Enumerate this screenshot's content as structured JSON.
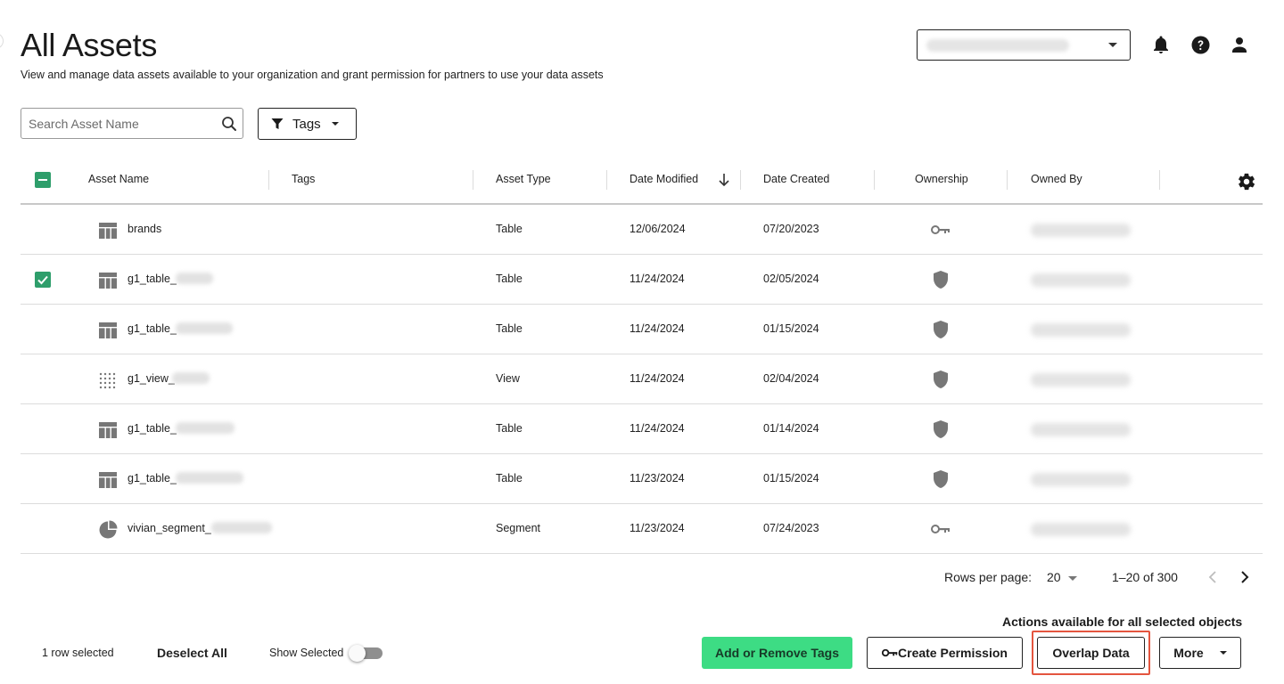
{
  "header": {
    "title": "All Assets",
    "subtitle": "View and manage data assets available to your organization and grant permission for partners to use your data assets",
    "icons": [
      "bell-icon",
      "help-icon",
      "user-icon"
    ]
  },
  "filters": {
    "search_placeholder": "Search Asset Name",
    "tags_label": "Tags"
  },
  "table": {
    "columns": {
      "asset_name": "Asset Name",
      "tags": "Tags",
      "asset_type": "Asset Type",
      "date_modified": "Date Modified",
      "date_created": "Date Created",
      "ownership": "Ownership",
      "owned_by": "Owned By"
    },
    "sort_indicator": "arrow-down-icon",
    "rows": [
      {
        "name": "brands",
        "type": "Table",
        "modified": "12/06/2024",
        "created": "07/20/2023",
        "ownership": "key-icon",
        "icon": "table-icon",
        "selected": false
      },
      {
        "name": "g1_table_",
        "type": "Table",
        "modified": "11/24/2024",
        "created": "02/05/2024",
        "ownership": "shield-icon",
        "icon": "table-icon",
        "selected": true
      },
      {
        "name": "g1_table_",
        "type": "Table",
        "modified": "11/24/2024",
        "created": "01/15/2024",
        "ownership": "shield-icon",
        "icon": "table-icon",
        "selected": false
      },
      {
        "name": "g1_view_",
        "type": "View",
        "modified": "11/24/2024",
        "created": "02/04/2024",
        "ownership": "shield-icon",
        "icon": "view-grid-icon",
        "selected": false
      },
      {
        "name": "g1_table_",
        "type": "Table",
        "modified": "11/24/2024",
        "created": "01/14/2024",
        "ownership": "shield-icon",
        "icon": "table-icon",
        "selected": false
      },
      {
        "name": "g1_table_",
        "type": "Table",
        "modified": "11/23/2024",
        "created": "01/15/2024",
        "ownership": "shield-icon",
        "icon": "table-icon",
        "selected": false
      },
      {
        "name": "vivian_segment_",
        "type": "Segment",
        "modified": "11/23/2024",
        "created": "07/24/2023",
        "ownership": "key-icon",
        "icon": "pie-chart-icon",
        "selected": false
      }
    ]
  },
  "pagination": {
    "rows_per_page_label": "Rows per page:",
    "rows_per_page_value": "20",
    "range": "1–20 of 300"
  },
  "footer": {
    "selected_count": "1 row selected",
    "deselect_all": "Deselect All",
    "show_selected": "Show Selected",
    "show_selected_on": false,
    "actions_caption": "Actions available for all selected objects",
    "add_remove_tags": "Add or Remove Tags",
    "create_permission": "Create Permission",
    "overlap_data": "Overlap Data",
    "more": "More"
  },
  "colors": {
    "accent_green": "#3ddc84",
    "checkbox_green": "#2e9e6b",
    "highlight_red": "#e4553f",
    "icon_gray": "#777777"
  }
}
